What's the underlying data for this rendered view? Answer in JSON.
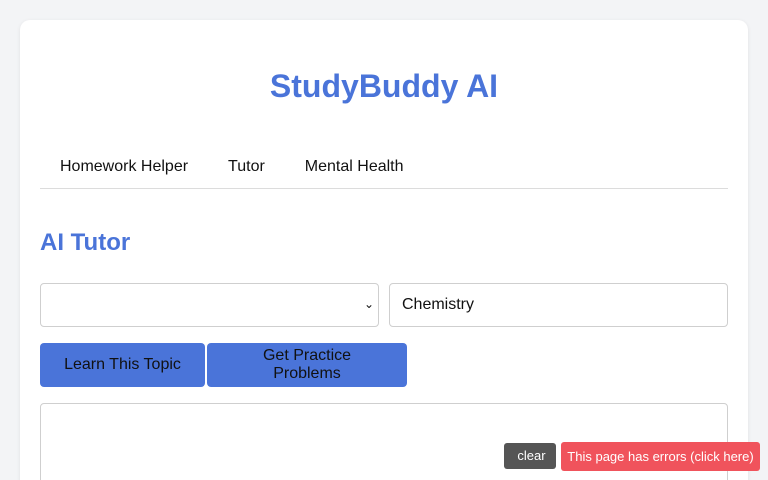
{
  "app": {
    "title": "StudyBuddy AI"
  },
  "nav": {
    "tabs": [
      {
        "label": "Homework Helper"
      },
      {
        "label": "Tutor"
      },
      {
        "label": "Mental Health"
      }
    ]
  },
  "tutor": {
    "title": "AI Tutor",
    "subject_select": {
      "value": ""
    },
    "topic_input": {
      "value": "Chemistry"
    },
    "learn_button": "Learn This Topic",
    "practice_button": "Get Practice Problems"
  },
  "error_overlay": {
    "clear_label": "clear",
    "message": "This page has errors (click here)"
  },
  "colors": {
    "accent": "#4a74d9",
    "error": "#f0535c",
    "clear_bg": "#555555"
  }
}
